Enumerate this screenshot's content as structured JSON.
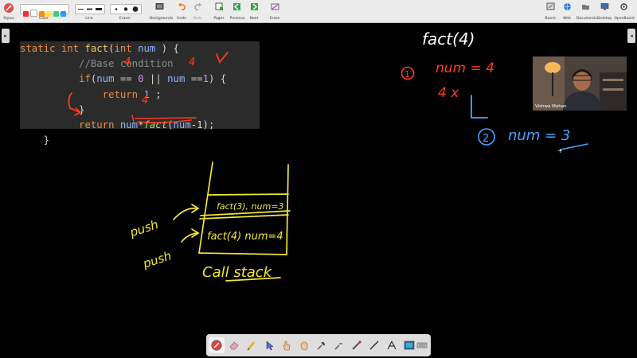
{
  "app": {
    "title": "Lecture whiteboard"
  },
  "toolbar": {
    "left_labels": {
      "stylus": "Stylus",
      "color": "Color",
      "line": "Line",
      "eraser": "Eraser"
    },
    "colors": [
      "#ff2d2d",
      "#ffffff",
      "#ff8a00",
      "#ffe14d",
      "#3ad07a",
      "#2a9bff"
    ],
    "buttons": [
      {
        "name": "backgrounds",
        "label": "Backgrounds",
        "icon": "backgrounds-icon"
      },
      {
        "name": "undo",
        "label": "Undo",
        "icon": "undo-icon"
      },
      {
        "name": "redo",
        "label": "Redo",
        "icon": "redo-icon"
      },
      {
        "name": "pages",
        "label": "Pages",
        "icon": "pages-icon"
      },
      {
        "name": "previous",
        "label": "Previous",
        "icon": "previous-icon"
      },
      {
        "name": "next",
        "label": "Next",
        "icon": "next-icon"
      },
      {
        "name": "erase",
        "label": "Erase",
        "icon": "erase-icon"
      }
    ],
    "right_buttons": [
      {
        "name": "board",
        "label": "Board",
        "icon": "board-icon"
      },
      {
        "name": "web",
        "label": "Web",
        "icon": "web-icon"
      },
      {
        "name": "documents",
        "label": "Documents",
        "icon": "documents-icon"
      },
      {
        "name": "desktop",
        "label": "Desktop",
        "icon": "desktop-icon"
      },
      {
        "name": "openboard",
        "label": "OpenBoard",
        "icon": "openboard-icon"
      }
    ]
  },
  "code": {
    "lines": [
      {
        "indent": "",
        "tokens": [
          {
            "t": "static int ",
            "c": "kw"
          },
          {
            "t": "fact",
            "c": "fn"
          },
          {
            "t": "(",
            "c": ""
          },
          {
            "t": "int ",
            "c": "kw"
          },
          {
            "t": "num",
            "c": "var"
          },
          {
            "t": " ) {",
            "c": ""
          }
        ]
      },
      {
        "indent": "          ",
        "tokens": [
          {
            "t": "//Base condition",
            "c": "cm"
          }
        ]
      },
      {
        "indent": "          ",
        "tokens": [
          {
            "t": "if",
            "c": "kw"
          },
          {
            "t": "(",
            "c": ""
          },
          {
            "t": "num",
            "c": "var"
          },
          {
            "t": " == ",
            "c": ""
          },
          {
            "t": "0",
            "c": "num"
          },
          {
            "t": " || ",
            "c": ""
          },
          {
            "t": "num",
            "c": "var"
          },
          {
            "t": " ==",
            "c": ""
          },
          {
            "t": "1",
            "c": "num"
          },
          {
            "t": ") {",
            "c": ""
          }
        ]
      },
      {
        "indent": "              ",
        "tokens": [
          {
            "t": "return ",
            "c": "kw"
          },
          {
            "t": "1",
            "c": "num"
          },
          {
            "t": " ;",
            "c": ""
          }
        ]
      },
      {
        "indent": "          ",
        "tokens": [
          {
            "t": "}",
            "c": ""
          }
        ]
      },
      {
        "indent": "          ",
        "tokens": [
          {
            "t": "return ",
            "c": "kw"
          },
          {
            "t": "num",
            "c": "var"
          },
          {
            "t": "*",
            "c": ""
          },
          {
            "t": "fact",
            "c": "fi"
          },
          {
            "t": "(",
            "c": ""
          },
          {
            "t": "num",
            "c": "var"
          },
          {
            "t": "-1);",
            "c": ""
          }
        ]
      },
      {
        "indent": "    ",
        "tokens": [
          {
            "t": "}",
            "c": ""
          }
        ]
      }
    ]
  },
  "video": {
    "presenter_name": "Vishwa Mohan"
  },
  "annotations": {
    "code_marks": {
      "four_a": "4",
      "four_b": "4",
      "four_c": "4"
    },
    "right": {
      "heading": "fact(4)",
      "step1_number": "1",
      "step1_text": "num = 4",
      "step1_result": "4 x",
      "step2_number": "2",
      "step2_text": "num = 3"
    },
    "stack": {
      "top_frame": "fact(3), num=3",
      "bottom_frame": "fact(4) num=4",
      "push_top": "push",
      "push_bottom": "push",
      "caption": "Call stack"
    }
  },
  "ink_colors": {
    "yellow": "#f2e63a",
    "red": "#ff3b1f",
    "blue": "#4aa3ff",
    "white": "#ffffff"
  },
  "bottom_toolbar": {
    "tools": [
      "pen-icon",
      "eraser-icon",
      "marker-icon",
      "pointer-icon",
      "hand-icon",
      "zoom-in-icon",
      "zoom-out-icon",
      "laser-icon",
      "line-icon",
      "text-icon",
      "capture-icon",
      "keyboard-icon"
    ]
  }
}
